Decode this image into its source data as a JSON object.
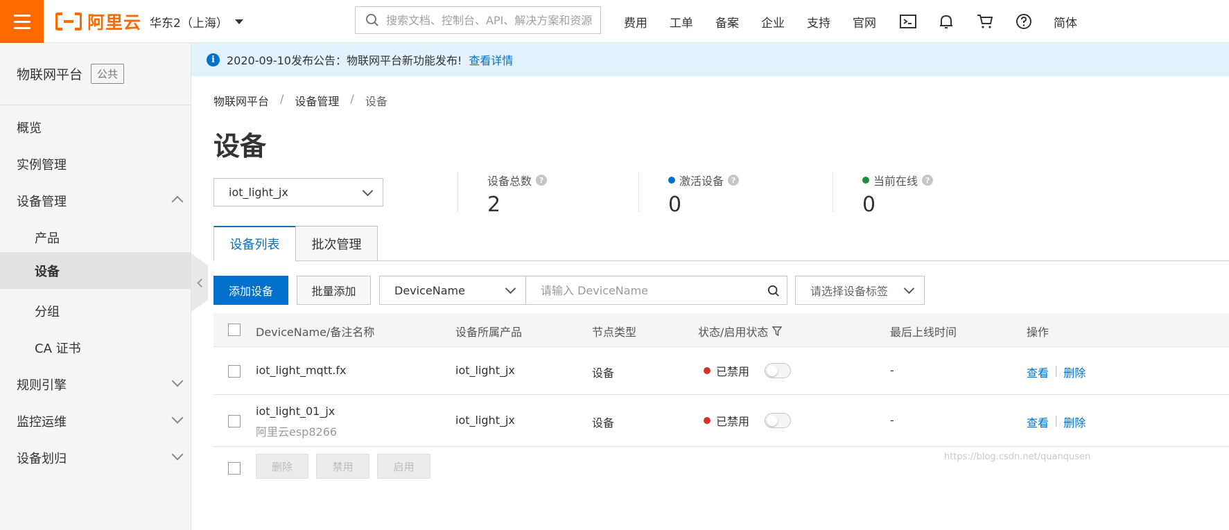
{
  "topbar": {
    "logo_text": "阿里云",
    "region": "华东2（上海）",
    "search_placeholder": "搜索文档、控制台、API、解决方案和资源",
    "nav": [
      "费用",
      "工单",
      "备案",
      "企业",
      "支持",
      "官网"
    ],
    "icons": [
      "terminal-icon",
      "bell-icon",
      "cart-icon",
      "help-icon"
    ],
    "lang": "简体",
    "brand_color": "#ff6a00"
  },
  "sidebar": {
    "title": "物联网平台",
    "tag": "公共",
    "items": [
      {
        "label": "概览"
      },
      {
        "label": "实例管理"
      },
      {
        "label": "设备管理",
        "expanded": true
      },
      {
        "label": "产品"
      },
      {
        "label": "设备",
        "active": true
      },
      {
        "label": "分组"
      },
      {
        "label": "CA 证书"
      },
      {
        "label": "规则引擎"
      },
      {
        "label": "监控运维"
      },
      {
        "label": "设备划归"
      }
    ]
  },
  "notice": {
    "text": "2020-09-10发布公告：物联网平台新功能发布!",
    "link": "查看详情"
  },
  "breadcrumb": [
    "物联网平台",
    "设备管理",
    "设备"
  ],
  "page_title": "设备",
  "product_select": "iot_light_jx",
  "stats": [
    {
      "label": "设备总数",
      "value": "2"
    },
    {
      "label": "激活设备",
      "value": "0",
      "dot_color": "#0070cc"
    },
    {
      "label": "当前在线",
      "value": "0",
      "dot_color": "#1e8e3e"
    }
  ],
  "tabs": [
    "设备列表",
    "批次管理"
  ],
  "toolbar": {
    "add_device": "添加设备",
    "batch_add": "批量添加",
    "filter_field": "DeviceName",
    "search_placeholder": "请输入 DeviceName",
    "tag_placeholder": "请选择设备标签"
  },
  "table": {
    "headers": [
      "DeviceName/备注名称",
      "设备所属产品",
      "节点类型",
      "状态/启用状态",
      "最后上线时间",
      "操作"
    ],
    "rows": [
      {
        "name": "iot_light_mqtt.fx",
        "note": "",
        "product": "iot_light_jx",
        "node_type": "设备",
        "status": "已禁用",
        "last_online": "-",
        "ops": [
          "查看",
          "删除"
        ]
      },
      {
        "name": "iot_light_01_jx",
        "note": "阿里云esp8266",
        "product": "iot_light_jx",
        "node_type": "设备",
        "status": "已禁用",
        "last_online": "-",
        "ops": [
          "查看",
          "删除"
        ]
      }
    ],
    "footer_buttons": [
      "删除",
      "禁用",
      "启用"
    ]
  },
  "watermark": "https://blog.csdn.net/quanqusen"
}
